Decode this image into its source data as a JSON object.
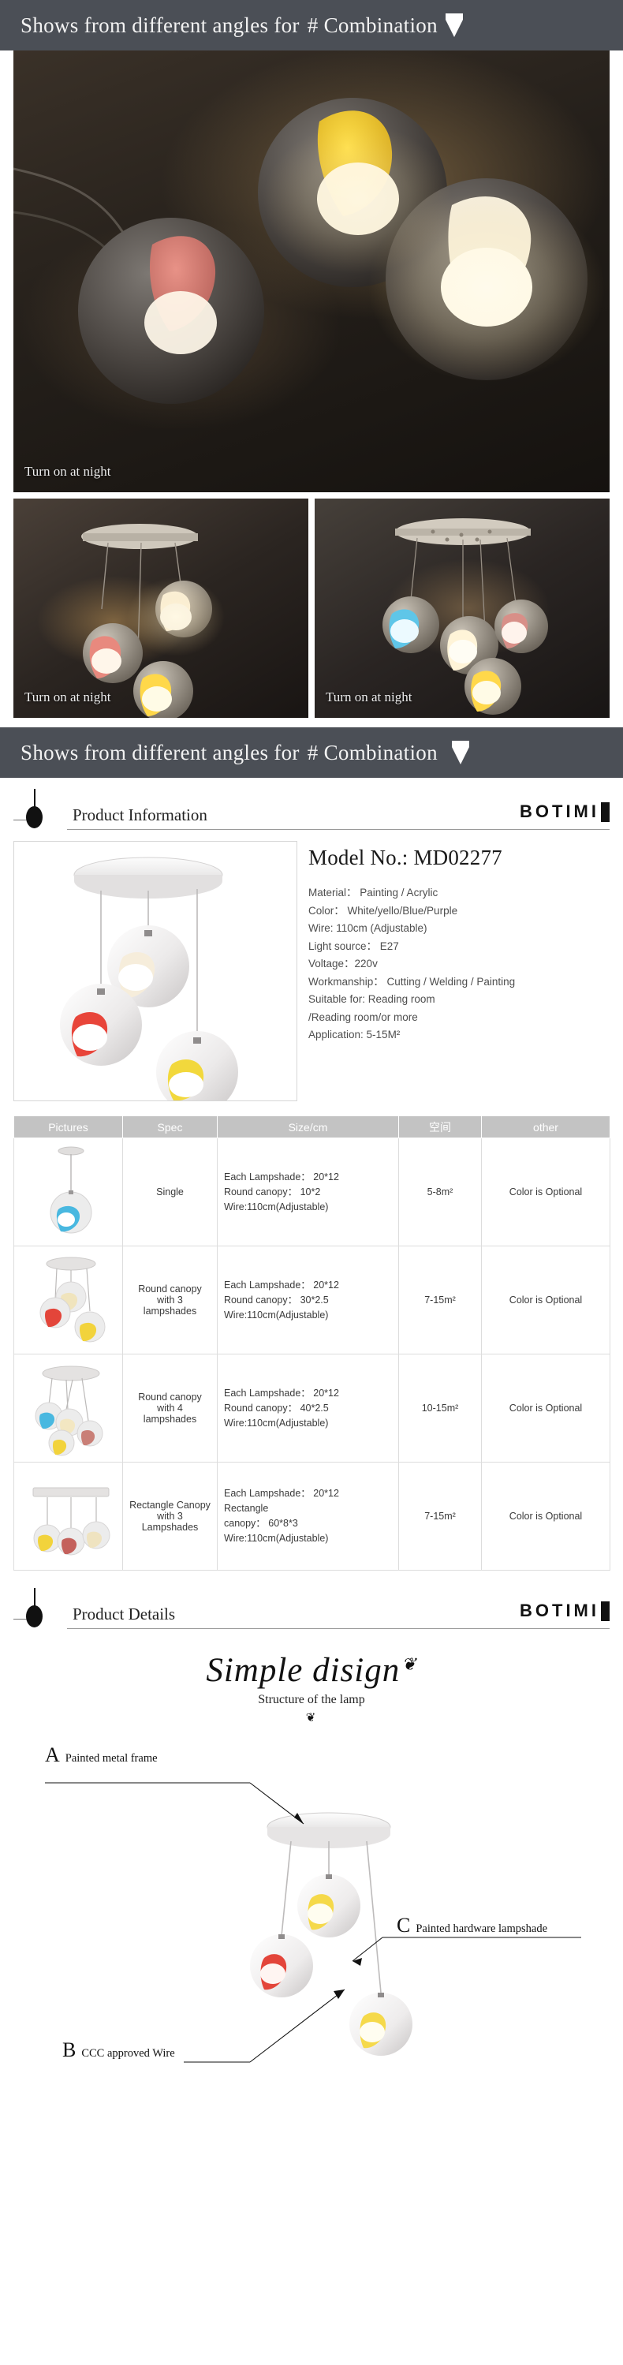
{
  "banners": [
    {
      "text": "Shows from different angles for",
      "hash_label": "# Combination",
      "mark": "triangle-mark"
    },
    {
      "text": "Shows from different angles for",
      "hash_label": "# Combination",
      "mark": "triangle-mark"
    }
  ],
  "photos": {
    "hero_caption": "Turn on at night",
    "left_caption": "Turn on at night",
    "right_caption": "Turn on at night"
  },
  "sections": {
    "product_information": {
      "title": "Product Information",
      "brand": "BOTIMI"
    },
    "product_details": {
      "title": "Product Details",
      "brand": "BOTIMI"
    }
  },
  "product": {
    "model_label": "Model No.: MD02277",
    "specs": [
      "Material： Painting / Acrylic",
      "Color： White/yello/Blue/Purple",
      "Wire: 110cm  (Adjustable)",
      "Light source： E27",
      "Voltage：220v",
      "Workmanship： Cutting / Welding / Painting",
      "Suitable for:  Reading room",
      "/Reading room/or more",
      "Application: 5-15M²"
    ]
  },
  "spec_table": {
    "headers": [
      "Pictures",
      "Spec",
      "Size/cm",
      "空间",
      "other"
    ],
    "rows": [
      {
        "picture": "single-pendant-thumbnail",
        "spec": "Single",
        "size": [
          "Each Lampshade： 20*12",
          "Round canopy： 10*2",
          "Wire:110cm(Adjustable)"
        ],
        "space": "5-8m²",
        "other": "Color is Optional"
      },
      {
        "picture": "round-canopy-3-lampshades-thumbnail",
        "spec": "Round canopy with 3 lampshades",
        "size": [
          "Each Lampshade： 20*12",
          "Round canopy： 30*2.5",
          "Wire:110cm(Adjustable)"
        ],
        "space": "7-15m²",
        "other": "Color is Optional"
      },
      {
        "picture": "round-canopy-4-lampshades-thumbnail",
        "spec": "Round canopy with 4 lampshades",
        "size": [
          "Each Lampshade： 20*12",
          "Round canopy： 40*2.5",
          "Wire:110cm(Adjustable)"
        ],
        "space": "10-15m²",
        "other": "Color is Optional"
      },
      {
        "picture": "rectangle-canopy-3-lampshades-thumbnail",
        "spec": "Rectangle Canopy with 3 Lampshades",
        "size": [
          "Each Lampshade： 20*12",
          "Rectangle",
          "canopy： 60*8*3",
          "Wire:110cm(Adjustable)"
        ],
        "space": "7-15m²",
        "other": "Color is Optional"
      }
    ]
  },
  "design": {
    "script_title": "Simple disign",
    "subtitle": "Structure of the lamp",
    "ornament": "❦"
  },
  "annotations": [
    {
      "letter": "A",
      "text": "Painted metal frame"
    },
    {
      "letter": "B",
      "text": "CCC approved Wire"
    },
    {
      "letter": "C",
      "text": "Painted hardware lampshade"
    }
  ],
  "colors": {
    "banner_bg": "#4b4f56",
    "table_header_bg": "#c3c3c3",
    "accent_yellow": "#f2d33c",
    "accent_blue": "#49b8e0",
    "accent_pink": "#e8705f",
    "accent_red": "#e3453a"
  }
}
